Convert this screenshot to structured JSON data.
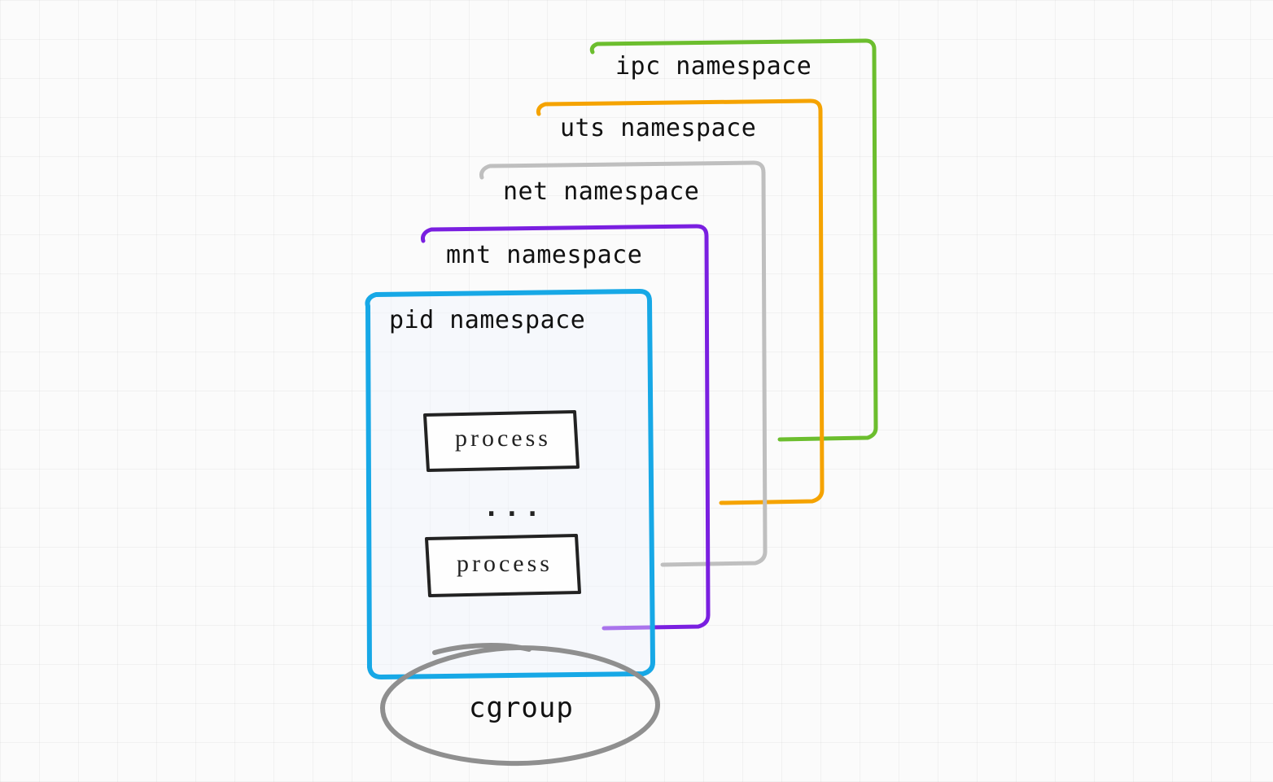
{
  "namespaces": {
    "pid": {
      "label": "pid namespace",
      "color": "#17a8e6"
    },
    "mnt": {
      "label": "mnt namespace",
      "color": "#7a1fe0"
    },
    "net": {
      "label": "net namespace",
      "color": "#bfbfbf"
    },
    "uts": {
      "label": "uts namespace",
      "color": "#f5a300"
    },
    "ipc": {
      "label": "ipc namespace",
      "color": "#6cbe2e"
    }
  },
  "processes": {
    "top": "process",
    "bottom": "process",
    "ellipsis": "..."
  },
  "cgroup": {
    "label": "cgroup",
    "color": "#8f8f8f"
  }
}
